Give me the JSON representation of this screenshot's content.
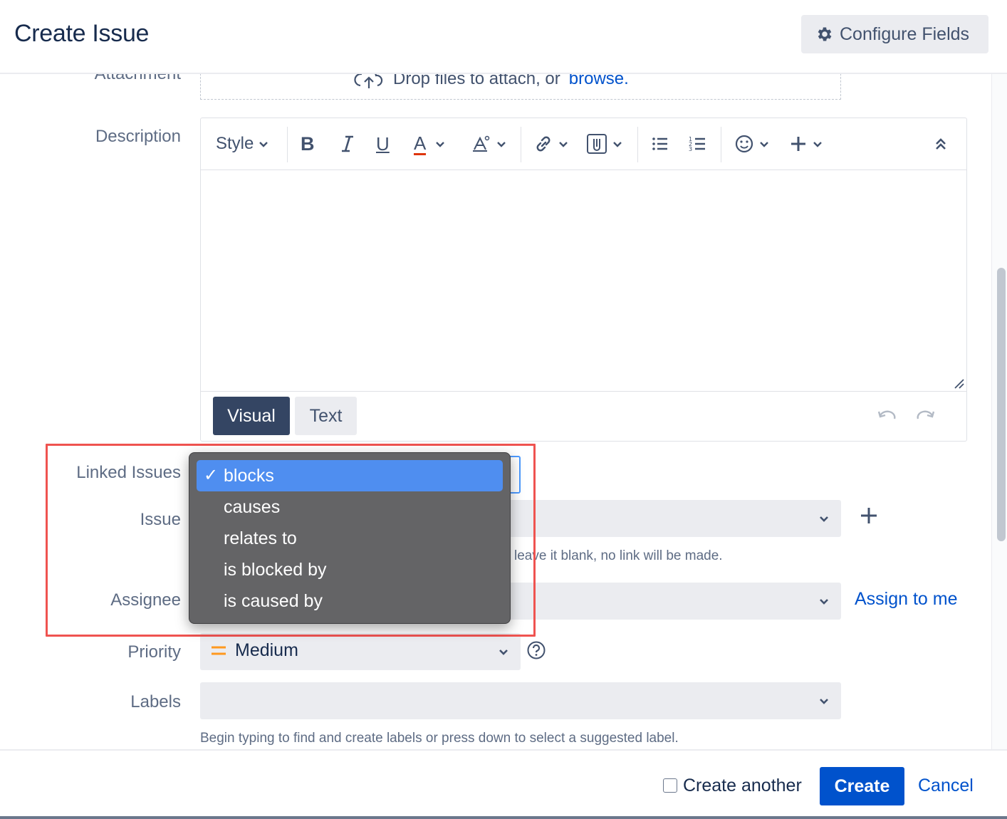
{
  "header": {
    "title": "Create Issue",
    "configure_label": "Configure Fields"
  },
  "attachment": {
    "label": "Attachment",
    "drop_text": "Drop files to attach, or",
    "browse_link": "browse."
  },
  "description": {
    "label": "Description",
    "toolbar": {
      "style_label": "Style",
      "bold": "B",
      "italic": "I",
      "underline": "U",
      "text_color": "A"
    },
    "modes": {
      "visual": "Visual",
      "text": "Text"
    }
  },
  "linked_issues": {
    "label": "Linked Issues",
    "options": [
      "blocks",
      "causes",
      "relates to",
      "is blocked by",
      "is caused by"
    ],
    "selected": "blocks"
  },
  "issue": {
    "label": "Issue",
    "hint": "leave it blank, no link will be made."
  },
  "assignee": {
    "label": "Assignee",
    "assign_to_me": "Assign to me"
  },
  "priority": {
    "label": "Priority",
    "value": "Medium",
    "color": "#ff991f"
  },
  "labels": {
    "label": "Labels",
    "hint": "Begin typing to find and create labels or press down to select a suggested label."
  },
  "footer": {
    "create_another": "Create another",
    "create": "Create",
    "cancel": "Cancel"
  },
  "colors": {
    "accent": "#0052cc",
    "highlight": "#ef5350",
    "dropdown_bg": "#646466",
    "dropdown_selected": "#4f8ef0"
  }
}
